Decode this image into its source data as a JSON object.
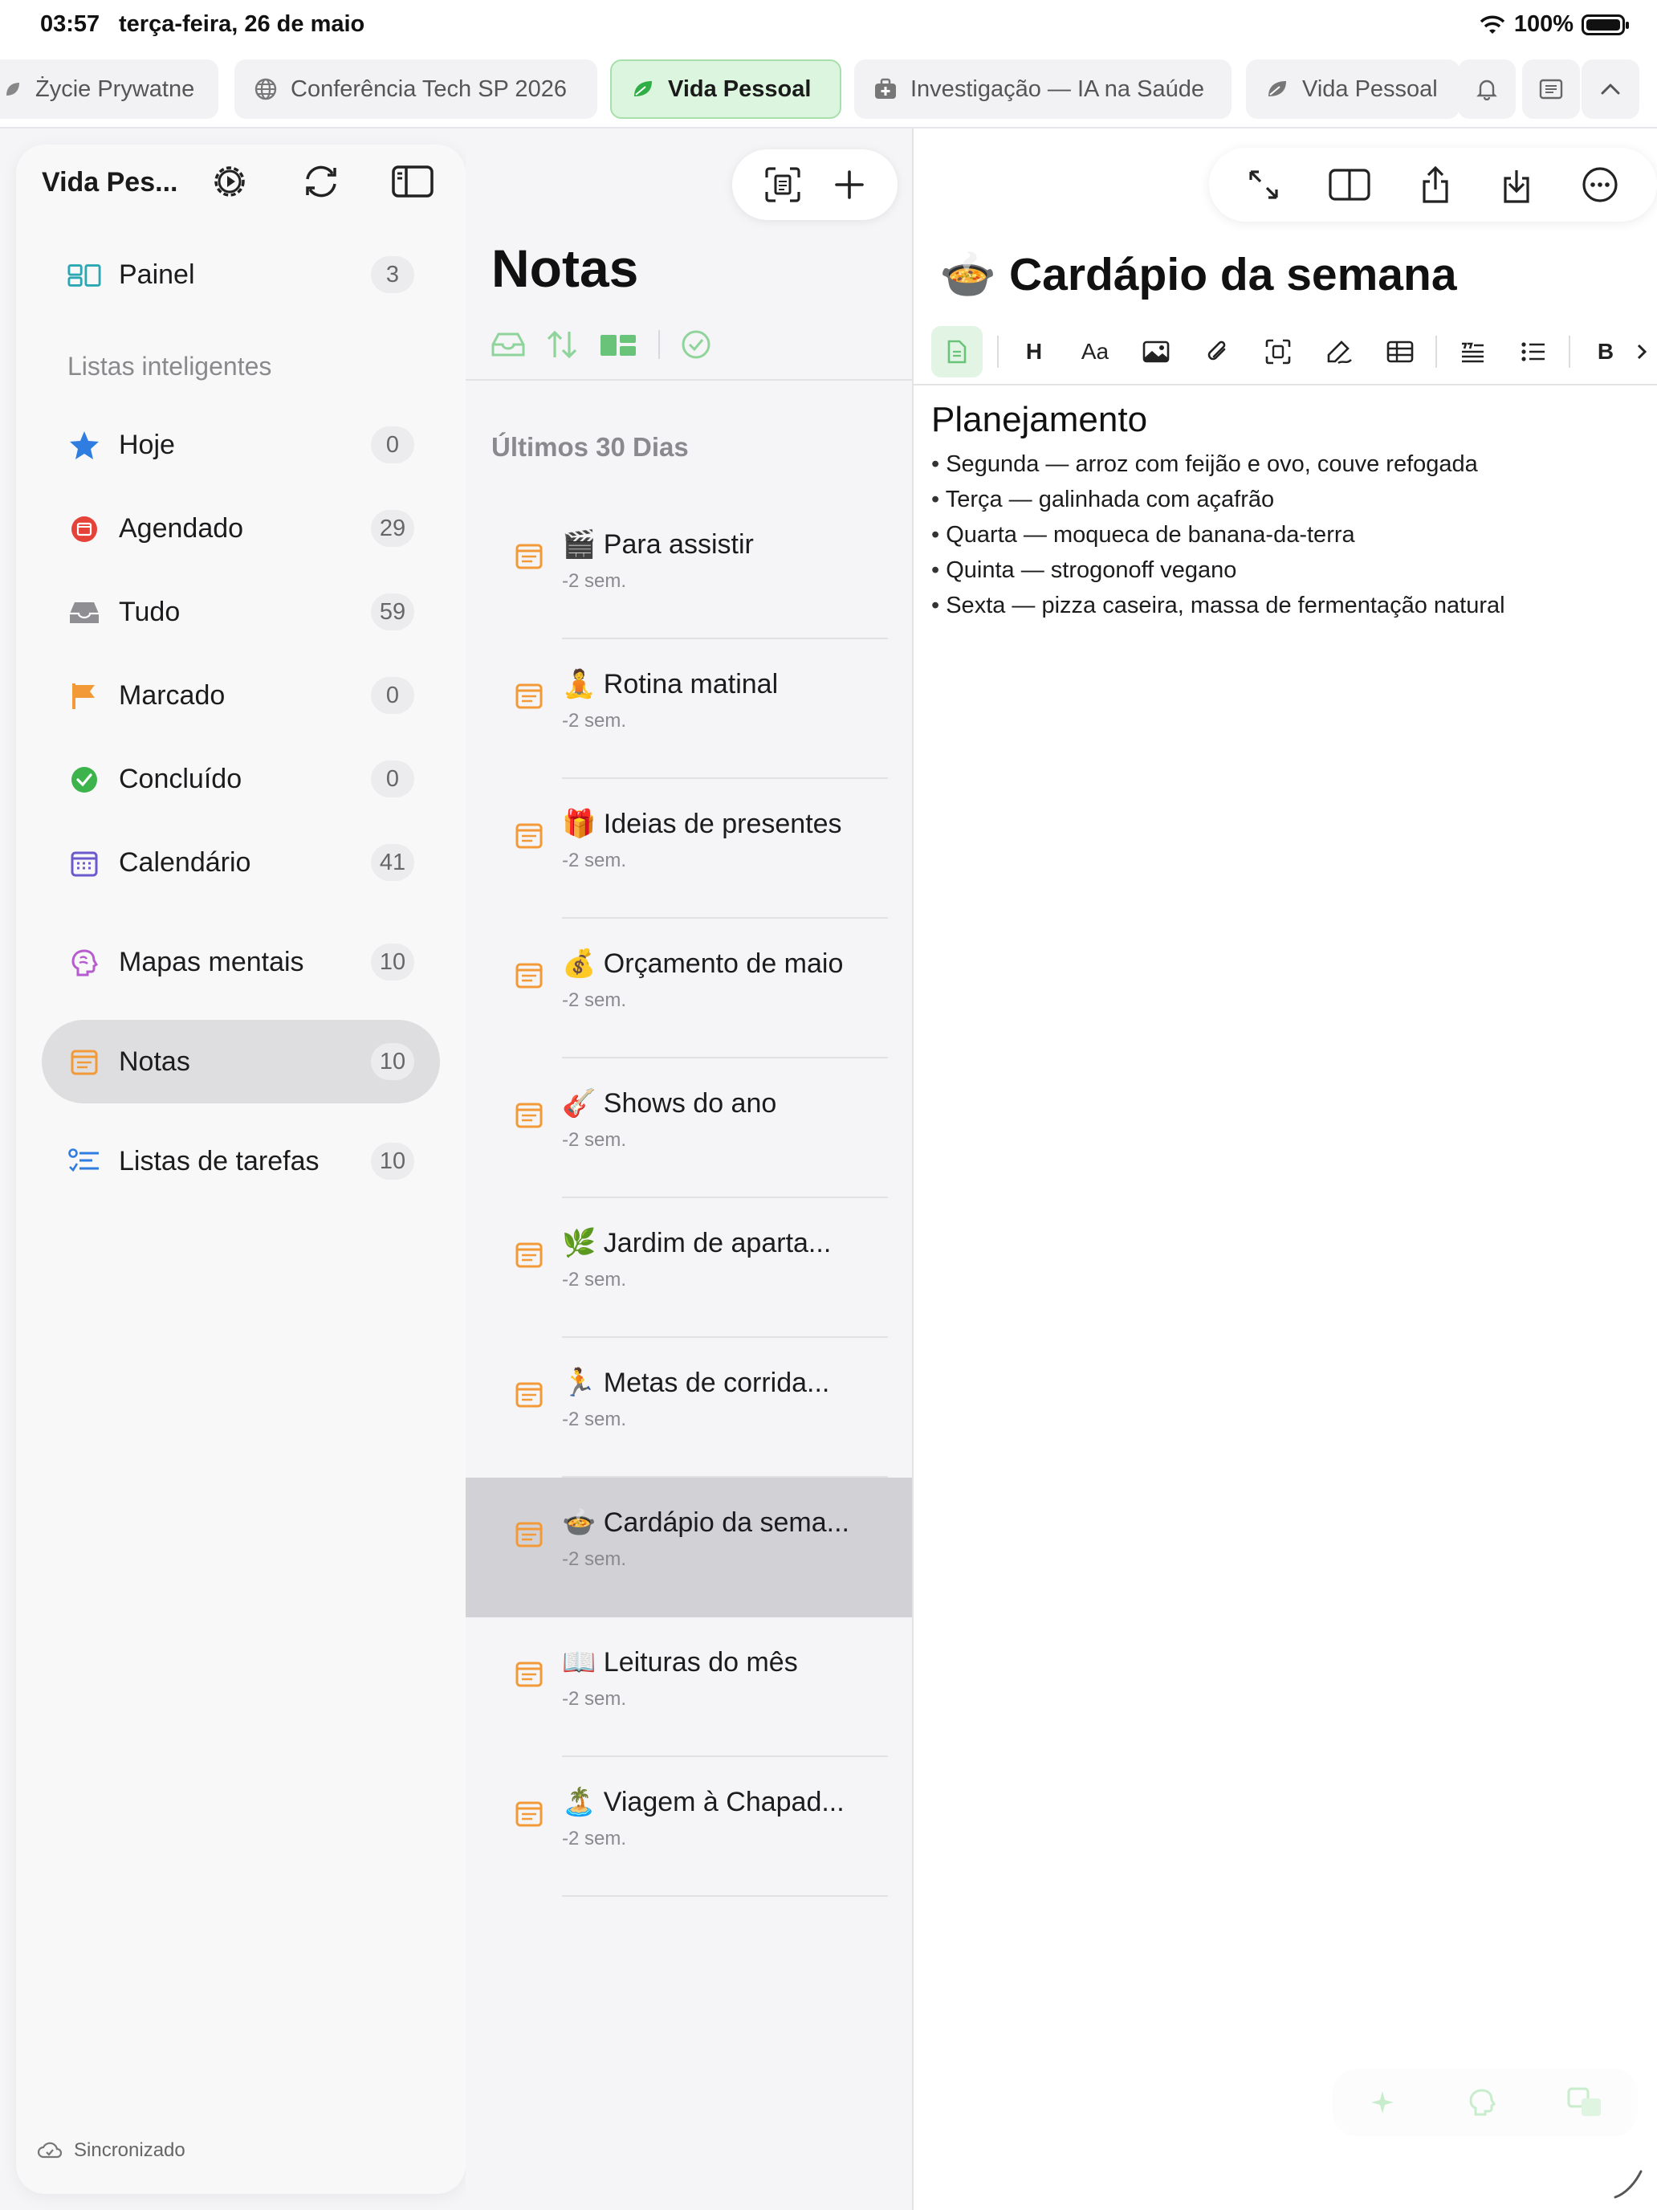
{
  "status_bar": {
    "time": "03:57",
    "date": "terça-feira, 26 de maio",
    "battery": "100%"
  },
  "tabs": [
    {
      "label": "Życie Prywatne",
      "icon": "leaf-icon",
      "active": false
    },
    {
      "label": "Conferência Tech SP 2026",
      "icon": "globe-icon",
      "active": false
    },
    {
      "label": "Vida Pessoal",
      "icon": "leaf-icon",
      "active": true
    },
    {
      "label": "Investigação — IA na Saúde",
      "icon": "medkit-icon",
      "active": false
    },
    {
      "label": "Vida Pessoal",
      "icon": "leaf-icon",
      "active": false
    }
  ],
  "sidebar": {
    "title": "Vida Pes...",
    "section_title": "Listas inteligentes",
    "sync_status": "Sincronizado",
    "items": [
      {
        "label": "Painel",
        "count": "3",
        "icon": "dashboard-icon"
      },
      {
        "label": "Hoje",
        "count": "0",
        "icon": "star-icon"
      },
      {
        "label": "Agendado",
        "count": "29",
        "icon": "scheduled-icon"
      },
      {
        "label": "Tudo",
        "count": "59",
        "icon": "inbox-icon"
      },
      {
        "label": "Marcado",
        "count": "0",
        "icon": "flag-icon"
      },
      {
        "label": "Concluído",
        "count": "0",
        "icon": "check-circle-icon"
      },
      {
        "label": "Calendário",
        "count": "41",
        "icon": "calendar-icon"
      },
      {
        "label": "Mapas mentais",
        "count": "10",
        "icon": "brain-icon"
      },
      {
        "label": "Notas",
        "count": "10",
        "icon": "note-icon",
        "active": true
      },
      {
        "label": "Listas de tarefas",
        "count": "10",
        "icon": "checklist-icon"
      }
    ]
  },
  "notes": {
    "title": "Notas",
    "group": "Últimos 30 Dias",
    "items": [
      {
        "emoji": "🎬",
        "title": "Para assistir",
        "time": "-2 sem."
      },
      {
        "emoji": "🧘",
        "title": "Rotina matinal",
        "time": "-2 sem."
      },
      {
        "emoji": "🎁",
        "title": "Ideias de presentes",
        "time": "-2 sem."
      },
      {
        "emoji": "💰",
        "title": "Orçamento de maio",
        "time": "-2 sem."
      },
      {
        "emoji": "🎸",
        "title": "Shows do ano",
        "time": "-2 sem."
      },
      {
        "emoji": "🌿",
        "title": "Jardim de aparta...",
        "time": "-2 sem."
      },
      {
        "emoji": "🏃",
        "title": "Metas de corrida...",
        "time": "-2 sem."
      },
      {
        "emoji": "🍲",
        "title": "Cardápio da sema...",
        "time": "-2 sem.",
        "selected": true
      },
      {
        "emoji": "📖",
        "title": "Leituras do mês",
        "time": "-2 sem."
      },
      {
        "emoji": "🏝️",
        "title": "Viagem à Chapad...",
        "time": "-2 sem."
      }
    ]
  },
  "editor": {
    "emoji": "🍲",
    "title": "Cardápio da semana",
    "heading": "Planejamento",
    "lines": [
      "Segunda — arroz com feijão e ovo, couve refogada",
      "Terça — galinhada com açafrão",
      "Quarta — moqueca de banana-da-terra",
      "Quinta — strogonoff vegano",
      "Sexta — pizza caseira, massa de fermentação natural"
    ],
    "format_labels": {
      "heading": "H",
      "text": "Aa",
      "bold": "B"
    }
  },
  "colors": {
    "accent_green": "#3cb44b",
    "note_orange": "#f29a38",
    "selected_row": "#d2d2d6"
  }
}
